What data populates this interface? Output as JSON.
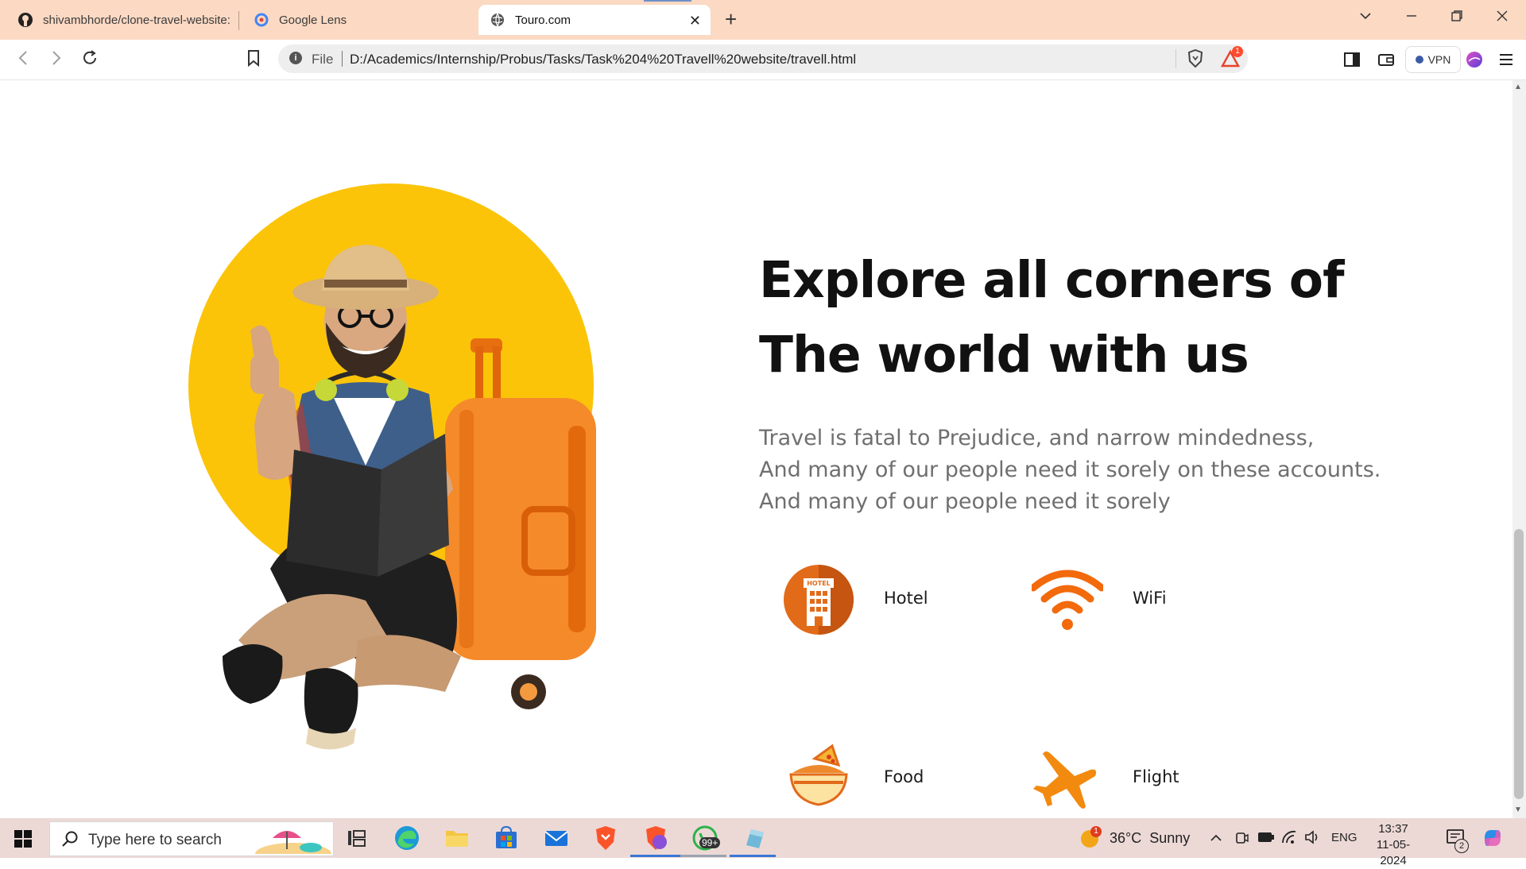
{
  "browser": {
    "tabs": [
      {
        "title": "shivambhorde/clone-travel-website:",
        "icon": "github-icon"
      },
      {
        "title": "Google Lens",
        "icon": "google-lens-icon"
      },
      {
        "title": "Touro.com",
        "icon": "globe-icon",
        "active": true
      }
    ],
    "address": {
      "scheme_label": "File",
      "url": "D:/Academics/Internship/Probus/Tasks/Task%204%20Travell%20website/travell.html"
    },
    "rewards_badge": "1",
    "vpn_label": "VPN"
  },
  "page": {
    "headline": [
      "Explore all corners of",
      "The world with us"
    ],
    "tagline": [
      "Travel is fatal to Prejudice, and narrow mindedness,",
      "And many of our people need it sorely on these accounts.",
      "And many of our people need it sorely"
    ],
    "hotel_sign": "HOTEL",
    "features": [
      {
        "label": "Hotel",
        "icon": "hotel-icon"
      },
      {
        "label": "WiFi",
        "icon": "wifi-icon"
      },
      {
        "label": "Food",
        "icon": "food-icon"
      },
      {
        "label": "Flight",
        "icon": "flight-icon"
      }
    ],
    "colors": {
      "accent_yellow": "#fbc409",
      "accent_orange": "#f26a0c"
    }
  },
  "taskbar": {
    "search_placeholder": "Type here to search",
    "whatsapp_badge": "99+",
    "weather": "36°C  Sunny",
    "weather_badge": "1",
    "language": "ENG",
    "time": "13:37",
    "date": "11-05-2024",
    "notification_count": "2"
  }
}
